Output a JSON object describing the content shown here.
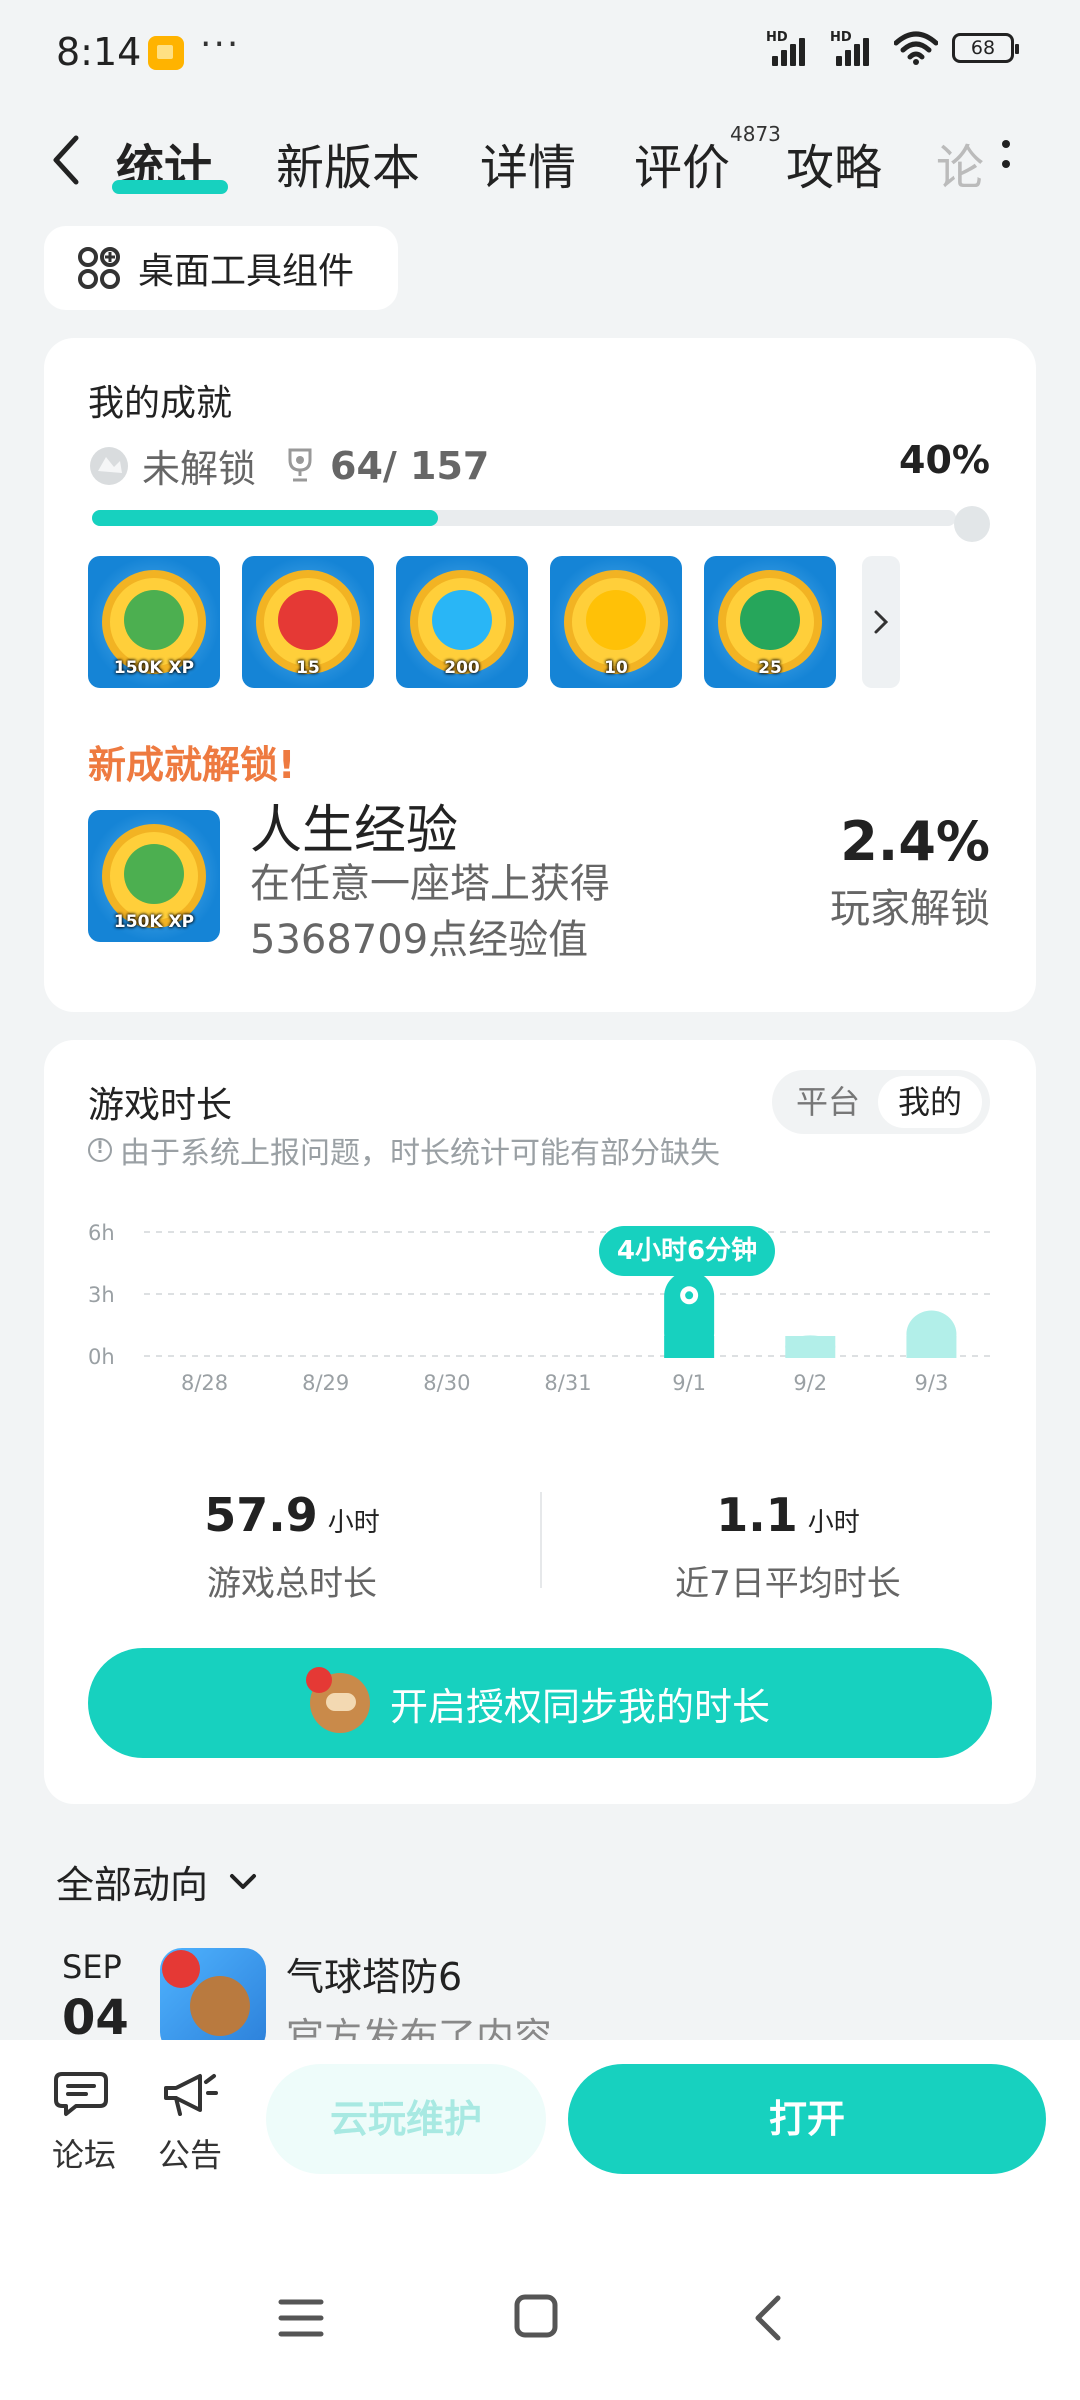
{
  "status_bar": {
    "time": "8:14",
    "dots": "···",
    "hd1": "HD",
    "hd2": "HD",
    "battery": "68"
  },
  "nav": {
    "tabs": [
      {
        "label": "统计",
        "active": true
      },
      {
        "label": "新版本"
      },
      {
        "label": "详情"
      },
      {
        "label": "评价",
        "badge": "4873"
      },
      {
        "label": "攻略"
      },
      {
        "label": "论"
      }
    ]
  },
  "widget_chip": {
    "label": "桌面工具组件"
  },
  "achievements": {
    "title": "我的成就",
    "status_label": "未解锁",
    "count": "64/ 157",
    "percent": "40%",
    "progress": 0.4,
    "badges": [
      {
        "num": "150K XP",
        "color": "#4caf50"
      },
      {
        "num": "15",
        "color": "#e53935"
      },
      {
        "num": "200",
        "color": "#29b6f6"
      },
      {
        "num": "10",
        "color": "#ffc107"
      },
      {
        "num": "25",
        "color": "#26a65b"
      }
    ],
    "new_title": "新成就解锁!",
    "new_badge_num": "150K XP",
    "new_name": "人生经验",
    "new_desc": "在任意一座塔上获得5368709点经验值",
    "new_percent": "2.4%",
    "new_percent_label": "玩家解锁"
  },
  "playtime": {
    "title": "游戏时长",
    "note": "由于系统上报问题，时长统计可能有部分缺失",
    "toggle": {
      "platform": "平台",
      "mine": "我的"
    },
    "tooltip": "4小时6分钟",
    "total_value": "57.9",
    "total_unit": "小时",
    "total_label": "游戏总时长",
    "avg_value": "1.1",
    "avg_unit": "小时",
    "avg_label": "近7日平均时长",
    "sync_button": "开启授权同步我的时长"
  },
  "chart_data": {
    "type": "bar",
    "categories": [
      "8/28",
      "8/29",
      "8/30",
      "8/31",
      "9/1",
      "9/2",
      "9/3"
    ],
    "values": [
      0,
      0,
      0,
      0,
      4.1,
      1.0,
      2.2
    ],
    "ylim": [
      0,
      6
    ],
    "yticks": [
      "6h",
      "3h",
      "0h"
    ],
    "highlight_index": 4,
    "colors": {
      "highlight": "#17d1bf",
      "normal": "#b2efe9"
    }
  },
  "updates": {
    "title": "全部动向",
    "items": [
      {
        "month": "SEP",
        "day": "04",
        "name": "气球塔防6",
        "desc": "官方发布了内容"
      }
    ]
  },
  "bottom_bar": {
    "forum": "论坛",
    "notice": "公告",
    "cloud": "云玩维护",
    "open": "打开"
  }
}
